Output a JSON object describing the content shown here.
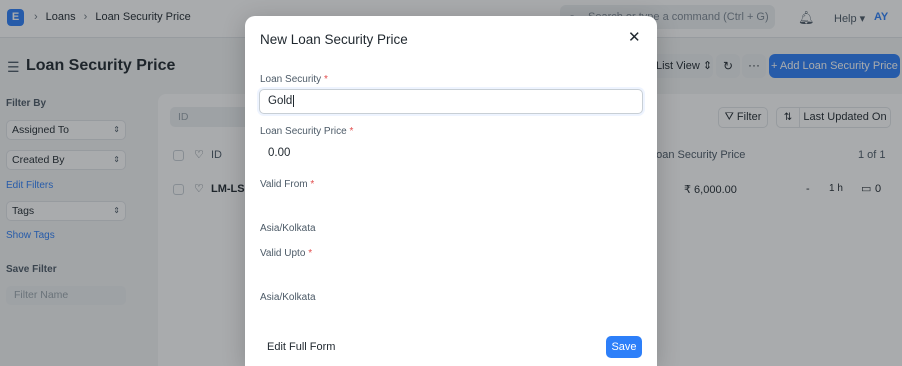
{
  "navbar": {
    "logo_letter": "E",
    "breadcrumbs": [
      "Loans",
      "Loan Security Price"
    ],
    "search_placeholder": "Search or type a command (Ctrl + G)",
    "help_label": "Help",
    "avatar_initials": "AY"
  },
  "page": {
    "title": "Loan Security Price",
    "list_view_label": "List View",
    "add_button_label": "+ Add Loan Security Price"
  },
  "sidebar": {
    "filter_by_label": "Filter By",
    "assigned_to": "Assigned To",
    "created_by": "Created By",
    "edit_filters": "Edit Filters",
    "tags": "Tags",
    "show_tags": "Show Tags",
    "save_filter_label": "Save Filter",
    "filter_name_placeholder": "Filter Name"
  },
  "list": {
    "id_filter_placeholder": "ID",
    "filter_button": "Filter",
    "sort_field": "Last Updated On",
    "columns": {
      "id": "ID",
      "security_price": "Loan Security Price",
      "count": "1 of 1"
    },
    "rows": [
      {
        "id": "LM-LSP",
        "price": "₹ 6,000.00",
        "dash": "-",
        "time": "1 h",
        "comments": "0"
      }
    ]
  },
  "modal": {
    "title": "New Loan Security Price",
    "fields": {
      "loan_security": {
        "label": "Loan Security",
        "value": "Gold"
      },
      "loan_security_price": {
        "label": "Loan Security Price",
        "value": "0.00"
      },
      "valid_from": {
        "label": "Valid From",
        "timezone": "Asia/Kolkata"
      },
      "valid_upto": {
        "label": "Valid Upto",
        "timezone": "Asia/Kolkata"
      }
    },
    "edit_full_form": "Edit Full Form",
    "save_label": "Save"
  },
  "colors": {
    "accent": "#2d7ff9",
    "required": "#e24c4c"
  }
}
